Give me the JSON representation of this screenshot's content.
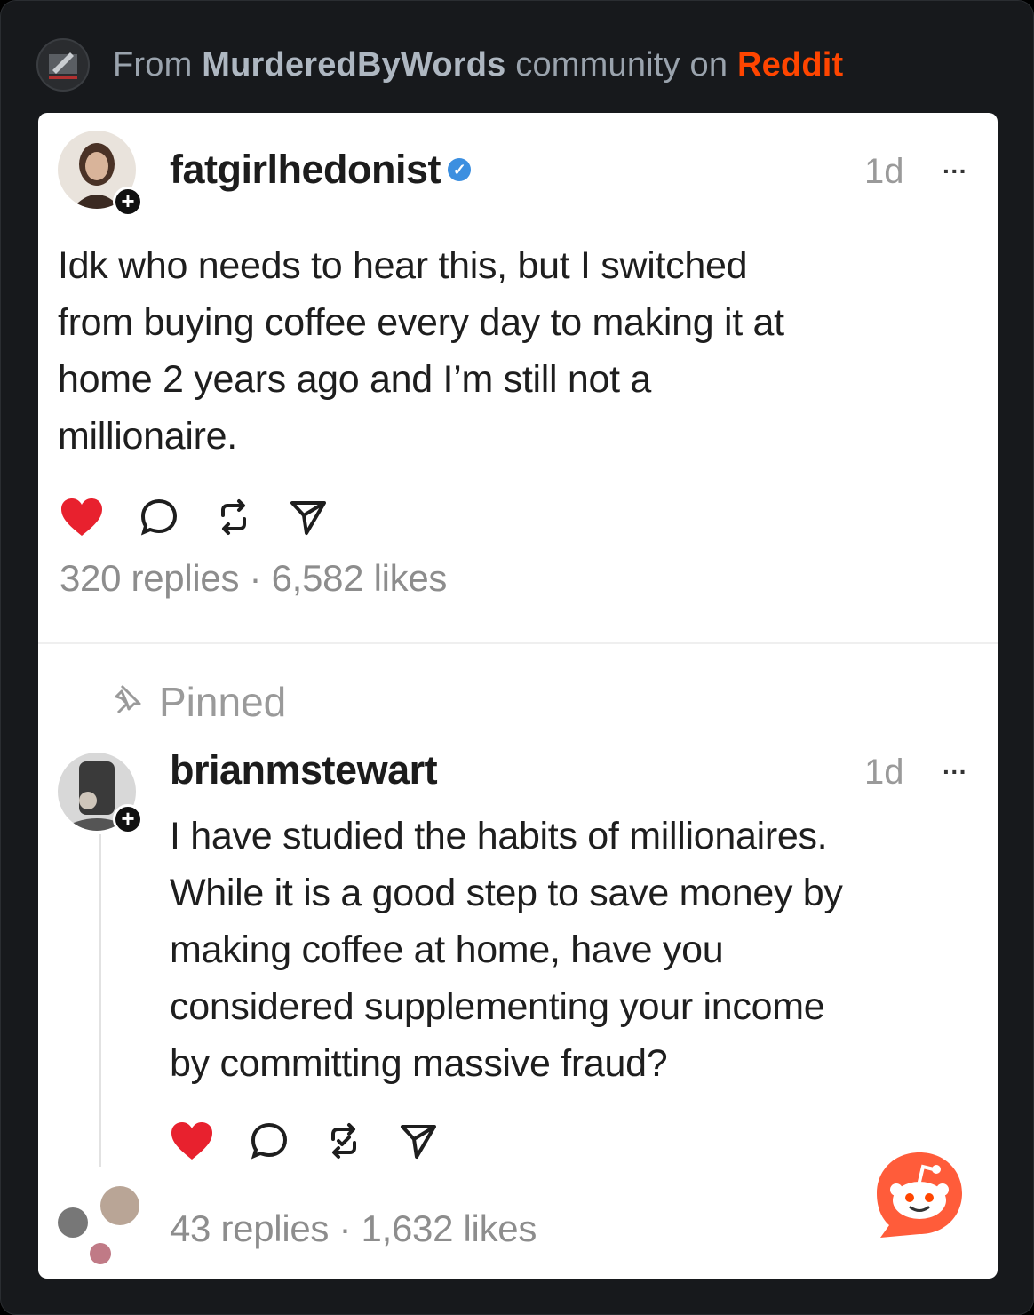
{
  "header": {
    "prefix": "From",
    "community": "MurderedByWords",
    "middle": "community on",
    "platform": "Reddit"
  },
  "post": {
    "username": "fatgirlhedonist",
    "time": "1d",
    "more": "···",
    "lines": [
      "Idk who needs to hear this, but I switched",
      "from buying coffee every day to making it at",
      "home 2 years ago and I’m still not a",
      "millionaire."
    ],
    "stats": "320 replies · 6,582 likes"
  },
  "reply": {
    "pinned_label": "Pinned",
    "username": "brianmstewart",
    "time": "1d",
    "more": "···",
    "lines": [
      "I have studied the habits of millionaires.",
      "While it is a good step to save money by",
      "making coffee at home, have you",
      "considered supplementing your income",
      "by committing massive fraud?"
    ],
    "stats": "43 replies · 1,632 likes"
  },
  "colors": {
    "reddit_orange": "#ff4500",
    "heart_red": "#e8212e",
    "verified_blue": "#3c8fe0"
  },
  "icons": {
    "community": "murderedbywords-community-icon",
    "like": "heart-icon",
    "reply": "comment-icon",
    "repost": "repost-icon",
    "share": "share-icon",
    "pin": "pin-icon",
    "brand": "reddit-snoo-logo"
  }
}
